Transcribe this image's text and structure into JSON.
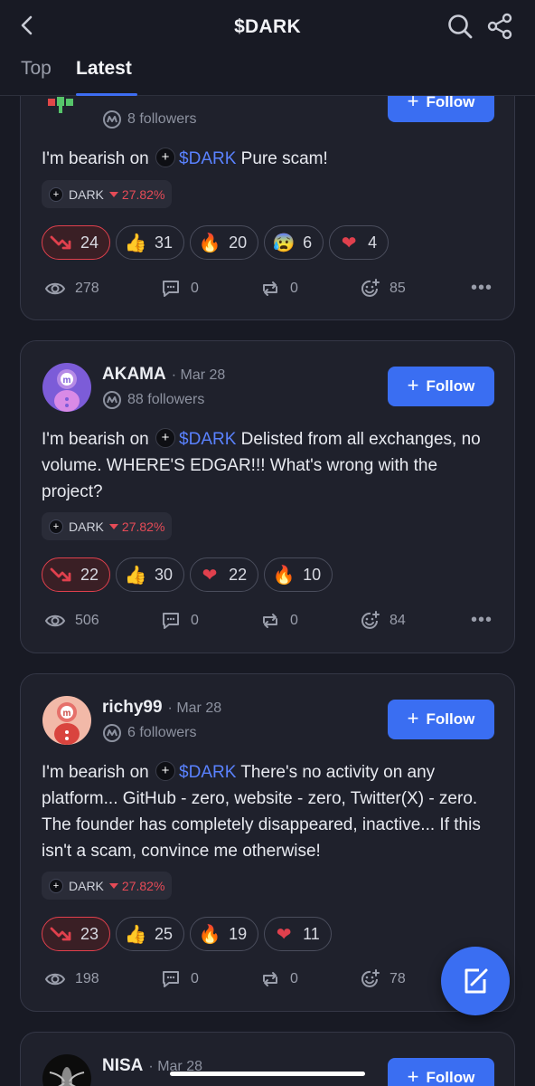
{
  "header": {
    "title": "$DARK",
    "tabs": [
      {
        "label": "Top"
      },
      {
        "label": "Latest"
      }
    ],
    "active_tab": "Latest"
  },
  "token": {
    "name": "DARK",
    "ticker": "$DARK",
    "change": "27.82%",
    "change_direction": "down",
    "change_color": "#e64b57"
  },
  "accent": "#3a6ef2",
  "posts": [
    {
      "user": "",
      "date": "",
      "followers": "8 followers",
      "follow_label": "Follow",
      "text_prefix": "I'm bearish on",
      "text_body": "Pure scam!",
      "reactions": [
        {
          "icon": "bearish-arrow-icon",
          "count": "24"
        },
        {
          "icon": "thumbs-up-icon",
          "count": "31"
        },
        {
          "icon": "fire-icon",
          "count": "20"
        },
        {
          "icon": "crying-face-icon",
          "count": "6"
        },
        {
          "icon": "heart-icon",
          "count": "4"
        }
      ],
      "views": "278",
      "comments": "0",
      "reposts": "0",
      "reacts_total": "85"
    },
    {
      "user": "AKAMA",
      "date": "Mar 28",
      "followers": "88 followers",
      "follow_label": "Follow",
      "text_prefix": "I'm bearish on",
      "text_body": "Delisted from all exchanges, no volume. WHERE'S EDGAR!!! What's wrong with the project?",
      "reactions": [
        {
          "icon": "bearish-arrow-icon",
          "count": "22"
        },
        {
          "icon": "thumbs-up-icon",
          "count": "30"
        },
        {
          "icon": "heart-icon",
          "count": "22"
        },
        {
          "icon": "fire-icon",
          "count": "10"
        }
      ],
      "views": "506",
      "comments": "0",
      "reposts": "0",
      "reacts_total": "84"
    },
    {
      "user": "richy99",
      "date": "Mar 28",
      "followers": "6 followers",
      "follow_label": "Follow",
      "text_prefix": "I'm bearish on",
      "text_body": "There's no activity on any platform... GitHub - zero, website - zero, Twitter(X) - zero. The founder has completely disappeared, inactive... If this isn't a scam, convince me otherwise!",
      "reactions": [
        {
          "icon": "bearish-arrow-icon",
          "count": "23"
        },
        {
          "icon": "thumbs-up-icon",
          "count": "25"
        },
        {
          "icon": "fire-icon",
          "count": "19"
        },
        {
          "icon": "heart-icon",
          "count": "11"
        }
      ],
      "views": "198",
      "comments": "0",
      "reposts": "0",
      "reacts_total": "78"
    },
    {
      "user": "NISA",
      "date": "Mar 28",
      "follow_label": "Follow"
    }
  ]
}
